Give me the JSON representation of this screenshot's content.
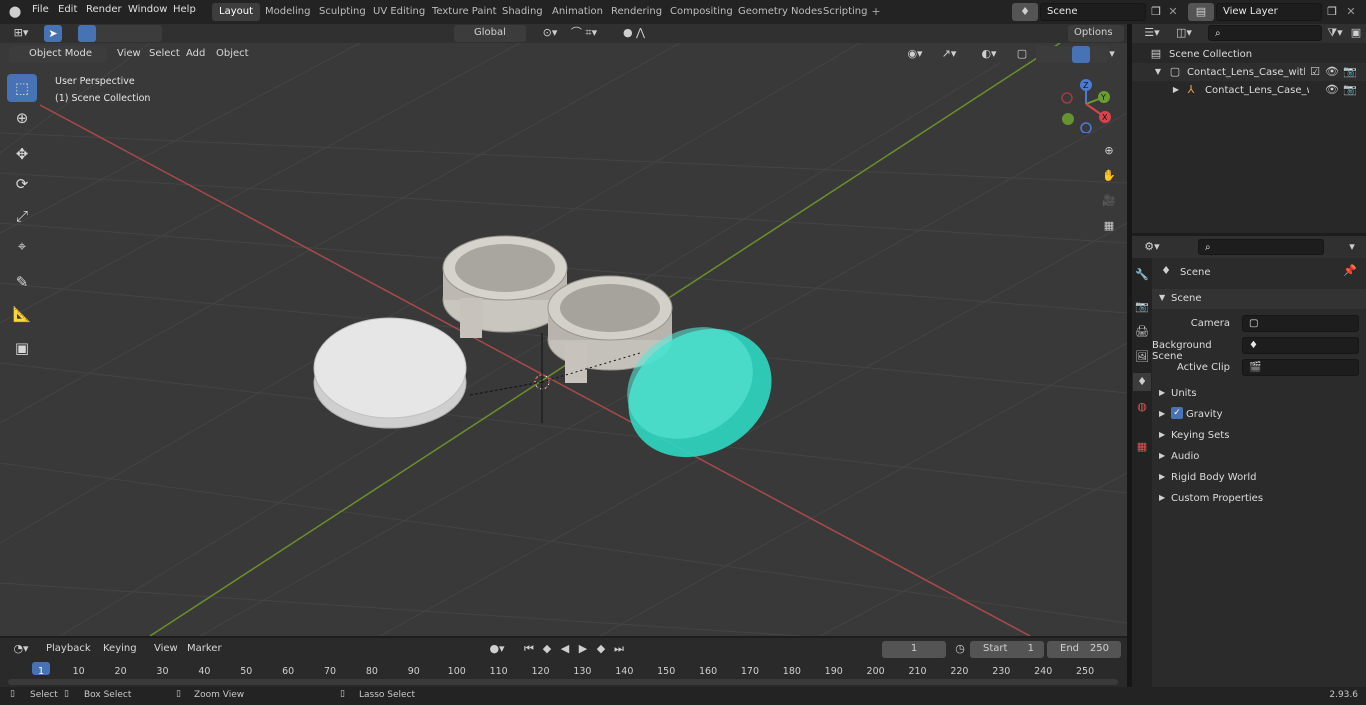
{
  "menus": [
    "File",
    "Edit",
    "Render",
    "Window",
    "Help"
  ],
  "workspaces": [
    "Layout",
    "Modeling",
    "Sculpting",
    "UV Editing",
    "Texture Paint",
    "Shading",
    "Animation",
    "Rendering",
    "Compositing",
    "Geometry Nodes",
    "Scripting"
  ],
  "scene_name": "Scene",
  "view_layer": "View Layer",
  "transform_orientation": "Global",
  "options_label": "Options",
  "mode": "Object Mode",
  "viewport_menus": [
    "View",
    "Select",
    "Add",
    "Object"
  ],
  "overlay_text": {
    "line1": "User Perspective",
    "line2": "(1) Scene Collection"
  },
  "gizmo_axes": {
    "x": "X",
    "y": "Y",
    "z": "Z"
  },
  "outliner": {
    "root": "Scene Collection",
    "items": [
      "Contact_Lens_Case_with_Opi",
      "Contact_Lens_Case_with"
    ]
  },
  "properties": {
    "header": "Scene",
    "panel": "Scene",
    "fields": [
      {
        "label": "Camera",
        "value": ""
      },
      {
        "label": "Background Scene",
        "value": ""
      },
      {
        "label": "Active Clip",
        "value": ""
      }
    ],
    "sections": [
      "Units",
      "Gravity",
      "Keying Sets",
      "Audio",
      "Rigid Body World",
      "Custom Properties"
    ]
  },
  "timeline": {
    "menus": [
      "Playback",
      "Keying",
      "View",
      "Marker"
    ],
    "current_frame": "1",
    "start_label": "Start",
    "start": "1",
    "end_label": "End",
    "end": "250",
    "ticks": [
      "1",
      "10",
      "20",
      "30",
      "40",
      "50",
      "60",
      "70",
      "80",
      "90",
      "100",
      "110",
      "120",
      "130",
      "140",
      "150",
      "160",
      "170",
      "180",
      "190",
      "200",
      "210",
      "220",
      "230",
      "240",
      "250"
    ]
  },
  "status": {
    "select": "Select",
    "box_select": "Box Select",
    "zoom_view": "Zoom View",
    "lasso_select": "Lasso Select",
    "version": "2.93.6"
  },
  "colors": {
    "accent": "#4772b3",
    "grid_x": "#a84a4a",
    "grid_y": "#6b8e2c",
    "lid_teal": "#2fd8c2"
  }
}
